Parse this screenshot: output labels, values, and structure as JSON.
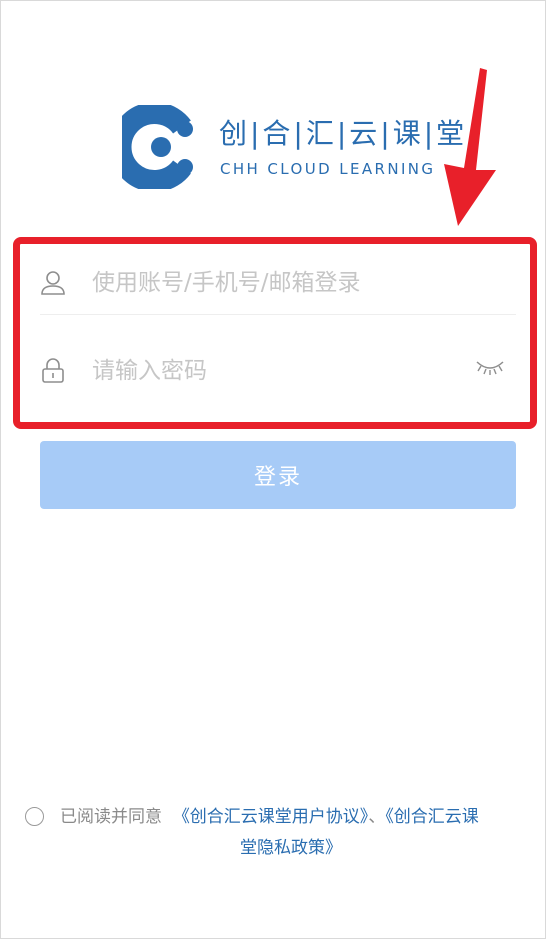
{
  "brand": {
    "name_cn": "创|合|汇|云|课|堂",
    "name_en": "CHH CLOUD LEARNING"
  },
  "login": {
    "username_placeholder": "使用账号/手机号/邮箱登录",
    "password_placeholder": "请输入密码",
    "submit_label": "登录"
  },
  "agreement": {
    "prefix": "已阅读并同意",
    "link_user_agreement": "《创合汇云课堂用户协议》",
    "separator": "、",
    "link_privacy_part1": "《创合汇云课",
    "link_privacy_part2": "堂隐私政策》"
  },
  "colors": {
    "brand_blue": "#2a6db0",
    "button_bg": "#a7cbf7",
    "annotation_red": "#e8202a"
  }
}
